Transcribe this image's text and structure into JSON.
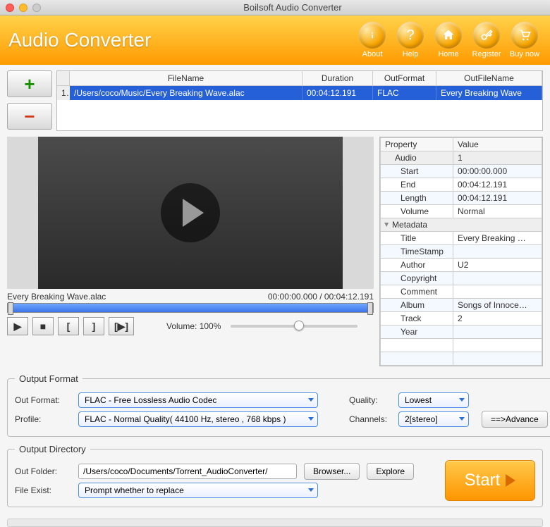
{
  "window": {
    "title": "Boilsoft Audio Converter"
  },
  "header": {
    "appName": "Audio Converter",
    "buttons": {
      "about": "About",
      "help": "Help",
      "home": "Home",
      "register": "Register",
      "buynow": "Buy now"
    }
  },
  "fileTable": {
    "columns": {
      "fileName": "FileName",
      "duration": "Duration",
      "outFormat": "OutFormat",
      "outFileName": "OutFileName"
    },
    "rows": [
      {
        "index": "1",
        "fileName": "/Users/coco/Music/Every Breaking Wave.alac",
        "duration": "00:04:12.191",
        "outFormat": "FLAC",
        "outFileName": "Every Breaking Wave"
      }
    ]
  },
  "player": {
    "currentFile": "Every Breaking Wave.alac",
    "timeDisplay": "00:00:00.000 / 00:04:12.191",
    "volumeLabel": "Volume: 100%",
    "volumePercent": 100
  },
  "properties": {
    "headers": {
      "property": "Property",
      "value": "Value"
    },
    "audioGroup": "Audio",
    "audioGroupVal": "1",
    "rows": [
      {
        "k": "Start",
        "v": "00:00:00.000"
      },
      {
        "k": "End",
        "v": "00:04:12.191"
      },
      {
        "k": "Length",
        "v": "00:04:12.191"
      },
      {
        "k": "Volume",
        "v": "Normal"
      }
    ],
    "metaGroup": "Metadata",
    "meta": [
      {
        "k": "Title",
        "v": "Every Breaking …"
      },
      {
        "k": "TimeStamp",
        "v": ""
      },
      {
        "k": "Author",
        "v": "U2"
      },
      {
        "k": "Copyright",
        "v": ""
      },
      {
        "k": "Comment",
        "v": ""
      },
      {
        "k": "Album",
        "v": "Songs of Innoce…"
      },
      {
        "k": "Track",
        "v": "2"
      },
      {
        "k": "Year",
        "v": ""
      }
    ]
  },
  "outputFormat": {
    "legend": "Output Format",
    "outFormatLabel": "Out Format:",
    "outFormatValue": "FLAC - Free Lossless Audio Codec",
    "profileLabel": "Profile:",
    "profileValue": "FLAC - Normal Quality( 44100 Hz, stereo , 768 kbps )",
    "qualityLabel": "Quality:",
    "qualityValue": "Lowest",
    "channelsLabel": "Channels:",
    "channelsValue": "2[stereo]",
    "advanceBtn": "==>Advance"
  },
  "outputDir": {
    "legend": "Output Directory",
    "outFolderLabel": "Out Folder:",
    "outFolderValue": "/Users/coco/Documents/Torrent_AudioConverter/",
    "browserBtn": "Browser...",
    "exploreBtn": "Explore",
    "fileExistLabel": "File Exist:",
    "fileExistValue": "Prompt whether to replace",
    "startBtn": "Start"
  }
}
